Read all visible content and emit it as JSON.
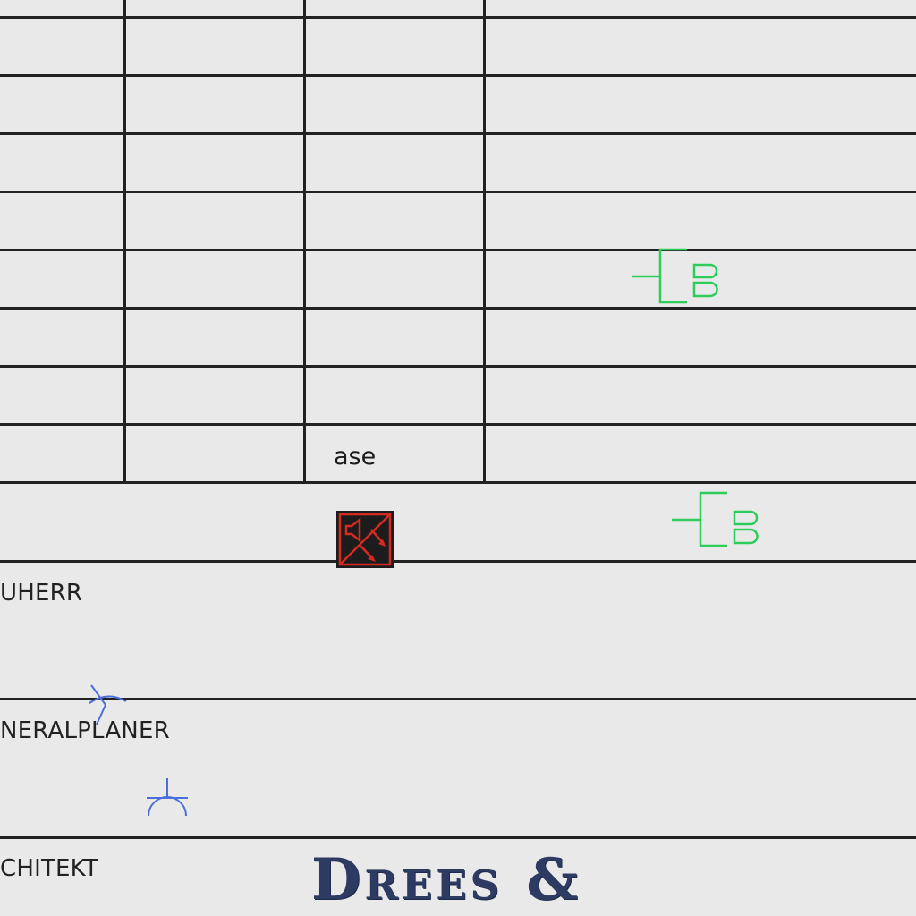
{
  "table": {
    "cell_phase": "ase"
  },
  "title_block": {
    "bauherr_label": "UHERR",
    "generalplaner_label": "NERALPLANER",
    "architekt_label": "CHITEKT"
  },
  "logo": {
    "text": "Drees &"
  },
  "colors": {
    "line": "#222222",
    "background": "#e9e9e9",
    "green_symbol": "#2ecc5a",
    "blue_symbol": "#4a6fd8",
    "red_symbol": "#d42a22",
    "logo_navy": "#2d3b63"
  },
  "icons": {
    "green_symbol": "outlet-symbol-icon",
    "speaker_symbol": "speaker-warning-icon",
    "blue_symbol": "antenna-symbol-icon"
  }
}
